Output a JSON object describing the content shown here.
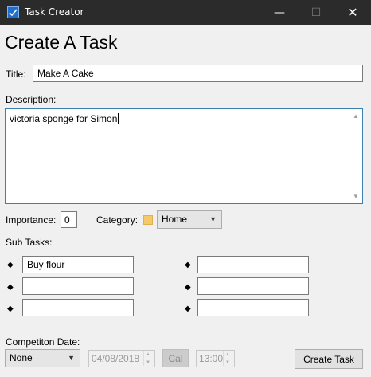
{
  "window": {
    "title": "Task Creator",
    "min_glyph": "—",
    "max_glyph": "☐",
    "close_glyph": "✕"
  },
  "form": {
    "heading": "Create A Task",
    "title_label": "Title:",
    "title_value": "Make A Cake",
    "description_label": "Description:",
    "description_value": "victoria sponge for Simon",
    "importance_label": "Importance:",
    "importance_value": "0",
    "category_label": "Category:",
    "category_color": "#f5c96a",
    "category_value": "Home",
    "subtasks_label": "Sub Tasks:",
    "subtasks": [
      "Buy flour",
      "",
      "",
      "",
      "",
      ""
    ],
    "date_label": "Competiton Date:",
    "competition_value": "None",
    "date_value": "04/08/2018",
    "cal_label": "Cal",
    "time_value": "13:00",
    "create_label": "Create Task"
  }
}
